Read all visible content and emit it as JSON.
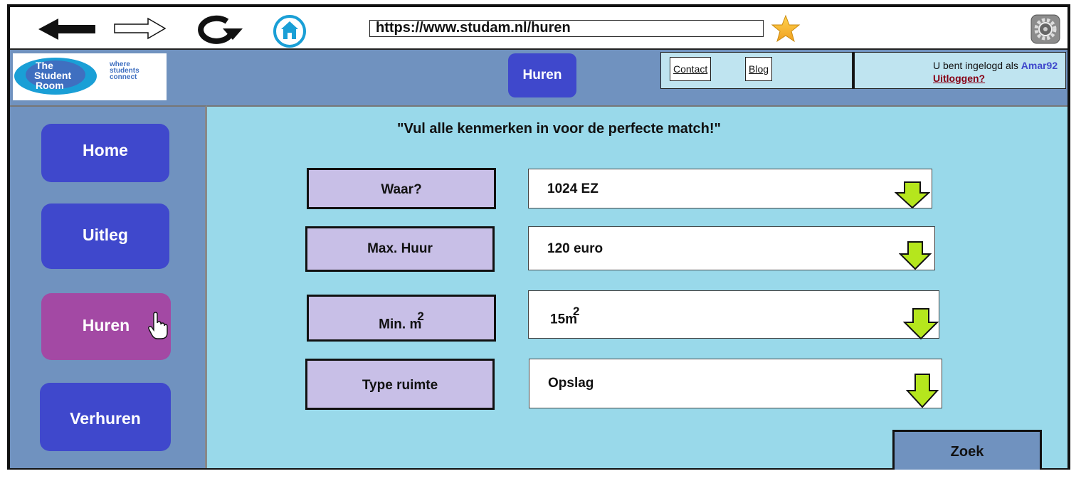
{
  "browser": {
    "url": "https://www.studam.nl/huren",
    "icons": [
      "back-arrow-icon",
      "forward-arrow-icon",
      "reload-icon",
      "home-icon",
      "star-icon",
      "gear-icon"
    ]
  },
  "header": {
    "logo_title": [
      "The",
      "Student",
      "Room"
    ],
    "logo_tagline": [
      "where",
      "students",
      "connect"
    ],
    "active_tab": "Huren",
    "links": {
      "contact": "Contact",
      "blog": "Blog"
    },
    "login_prefix": "U bent ingelogd als ",
    "username": "Amar92",
    "logout": "Uitloggen?"
  },
  "sidebar": {
    "items": [
      {
        "label": "Home"
      },
      {
        "label": "Uitleg"
      },
      {
        "label": "Huren",
        "active": true
      },
      {
        "label": "Verhuren"
      }
    ]
  },
  "main": {
    "headline": "\"Vul alle kenmerken in voor de perfecte match!\"",
    "fields": [
      {
        "label": "Waar?",
        "value": "1024 EZ"
      },
      {
        "label": "Max. Huur",
        "value": "120 euro"
      },
      {
        "label": "Min. m",
        "label_sup": "2",
        "value": "15m",
        "value_sup": "2"
      },
      {
        "label": "Type ruimte",
        "value": "Opslag"
      }
    ],
    "search_button": "Zoek"
  },
  "colors": {
    "accent": "#3f48cc",
    "active": "#a349a4",
    "header_bg": "#7092bf",
    "main_bg": "#99d9ea",
    "label_bg": "#c8bfe7",
    "dropdown_arrow": "#b5e61d"
  }
}
